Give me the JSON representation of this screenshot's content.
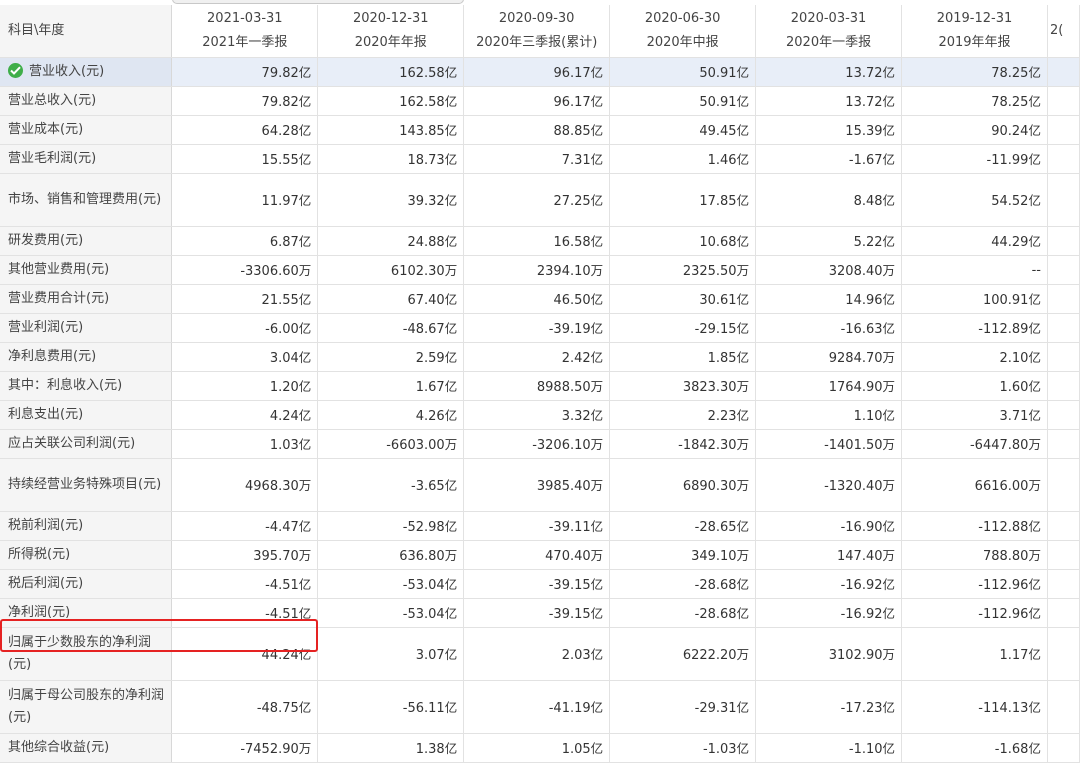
{
  "header": {
    "label": "科目\\年度",
    "columns": [
      {
        "date": "2021-03-31",
        "period": "2021年一季报"
      },
      {
        "date": "2020-12-31",
        "period": "2020年年报"
      },
      {
        "date": "2020-09-30",
        "period": "2020年三季报(累计)"
      },
      {
        "date": "2020-06-30",
        "period": "2020年中报"
      },
      {
        "date": "2020-03-31",
        "period": "2020年一季报"
      },
      {
        "date": "2019-12-31",
        "period": "2019年年报"
      },
      {
        "date": "",
        "period": "2("
      }
    ]
  },
  "rows": [
    {
      "label": "营业收入(元)",
      "values": [
        [
          "79.82",
          "亿"
        ],
        [
          "162.58",
          "亿"
        ],
        [
          "96.17",
          "亿"
        ],
        [
          "50.91",
          "亿"
        ],
        [
          "13.72",
          "亿"
        ],
        [
          "78.25",
          "亿"
        ]
      ]
    },
    {
      "label": "营业总收入(元)",
      "values": [
        [
          "79.82",
          "亿"
        ],
        [
          "162.58",
          "亿"
        ],
        [
          "96.17",
          "亿"
        ],
        [
          "50.91",
          "亿"
        ],
        [
          "13.72",
          "亿"
        ],
        [
          "78.25",
          "亿"
        ]
      ]
    },
    {
      "label": "营业成本(元)",
      "values": [
        [
          "64.28",
          "亿"
        ],
        [
          "143.85",
          "亿"
        ],
        [
          "88.85",
          "亿"
        ],
        [
          "49.45",
          "亿"
        ],
        [
          "15.39",
          "亿"
        ],
        [
          "90.24",
          "亿"
        ]
      ]
    },
    {
      "label": "营业毛利润(元)",
      "values": [
        [
          "15.55",
          "亿"
        ],
        [
          "18.73",
          "亿"
        ],
        [
          "7.31",
          "亿"
        ],
        [
          "1.46",
          "亿"
        ],
        [
          "-1.67",
          "亿"
        ],
        [
          "-11.99",
          "亿"
        ]
      ]
    },
    {
      "label": "市场、销售和管理费用(元)",
      "values": [
        [
          "11.97",
          "亿"
        ],
        [
          "39.32",
          "亿"
        ],
        [
          "27.25",
          "亿"
        ],
        [
          "17.85",
          "亿"
        ],
        [
          "8.48",
          "亿"
        ],
        [
          "54.52",
          "亿"
        ]
      ]
    },
    {
      "label": "研发费用(元)",
      "values": [
        [
          "6.87",
          "亿"
        ],
        [
          "24.88",
          "亿"
        ],
        [
          "16.58",
          "亿"
        ],
        [
          "10.68",
          "亿"
        ],
        [
          "5.22",
          "亿"
        ],
        [
          "44.29",
          "亿"
        ]
      ]
    },
    {
      "label": "其他营业费用(元)",
      "values": [
        [
          "-3306.60",
          "万"
        ],
        [
          "6102.30",
          "万"
        ],
        [
          "2394.10",
          "万"
        ],
        [
          "2325.50",
          "万"
        ],
        [
          "3208.40",
          "万"
        ],
        [
          "--",
          ""
        ]
      ]
    },
    {
      "label": "营业费用合计(元)",
      "values": [
        [
          "21.55",
          "亿"
        ],
        [
          "67.40",
          "亿"
        ],
        [
          "46.50",
          "亿"
        ],
        [
          "30.61",
          "亿"
        ],
        [
          "14.96",
          "亿"
        ],
        [
          "100.91",
          "亿"
        ]
      ]
    },
    {
      "label": "营业利润(元)",
      "values": [
        [
          "-6.00",
          "亿"
        ],
        [
          "-48.67",
          "亿"
        ],
        [
          "-39.19",
          "亿"
        ],
        [
          "-29.15",
          "亿"
        ],
        [
          "-16.63",
          "亿"
        ],
        [
          "-112.89",
          "亿"
        ]
      ]
    },
    {
      "label": "净利息费用(元)",
      "values": [
        [
          "3.04",
          "亿"
        ],
        [
          "2.59",
          "亿"
        ],
        [
          "2.42",
          "亿"
        ],
        [
          "1.85",
          "亿"
        ],
        [
          "9284.70",
          "万"
        ],
        [
          "2.10",
          "亿"
        ]
      ]
    },
    {
      "label": "其中：利息收入(元)",
      "values": [
        [
          "1.20",
          "亿"
        ],
        [
          "1.67",
          "亿"
        ],
        [
          "8988.50",
          "万"
        ],
        [
          "3823.30",
          "万"
        ],
        [
          "1764.90",
          "万"
        ],
        [
          "1.60",
          "亿"
        ]
      ]
    },
    {
      "label": "利息支出(元)",
      "values": [
        [
          "4.24",
          "亿"
        ],
        [
          "4.26",
          "亿"
        ],
        [
          "3.32",
          "亿"
        ],
        [
          "2.23",
          "亿"
        ],
        [
          "1.10",
          "亿"
        ],
        [
          "3.71",
          "亿"
        ]
      ]
    },
    {
      "label": "应占关联公司利润(元)",
      "values": [
        [
          "1.03",
          "亿"
        ],
        [
          "-6603.00",
          "万"
        ],
        [
          "-3206.10",
          "万"
        ],
        [
          "-1842.30",
          "万"
        ],
        [
          "-1401.50",
          "万"
        ],
        [
          "-6447.80",
          "万"
        ]
      ]
    },
    {
      "label": "持续经营业务特殊项目(元)",
      "values": [
        [
          "4968.30",
          "万"
        ],
        [
          "-3.65",
          "亿"
        ],
        [
          "3985.40",
          "万"
        ],
        [
          "6890.30",
          "万"
        ],
        [
          "-1320.40",
          "万"
        ],
        [
          "6616.00",
          "万"
        ]
      ]
    },
    {
      "label": "税前利润(元)",
      "values": [
        [
          "-4.47",
          "亿"
        ],
        [
          "-52.98",
          "亿"
        ],
        [
          "-39.11",
          "亿"
        ],
        [
          "-28.65",
          "亿"
        ],
        [
          "-16.90",
          "亿"
        ],
        [
          "-112.88",
          "亿"
        ]
      ]
    },
    {
      "label": "所得税(元)",
      "values": [
        [
          "395.70",
          "万"
        ],
        [
          "636.80",
          "万"
        ],
        [
          "470.40",
          "万"
        ],
        [
          "349.10",
          "万"
        ],
        [
          "147.40",
          "万"
        ],
        [
          "788.80",
          "万"
        ]
      ]
    },
    {
      "label": "税后利润(元)",
      "values": [
        [
          "-4.51",
          "亿"
        ],
        [
          "-53.04",
          "亿"
        ],
        [
          "-39.15",
          "亿"
        ],
        [
          "-28.68",
          "亿"
        ],
        [
          "-16.92",
          "亿"
        ],
        [
          "-112.96",
          "亿"
        ]
      ]
    },
    {
      "label": "净利润(元)",
      "values": [
        [
          "-4.51",
          "亿"
        ],
        [
          "-53.04",
          "亿"
        ],
        [
          "-39.15",
          "亿"
        ],
        [
          "-28.68",
          "亿"
        ],
        [
          "-16.92",
          "亿"
        ],
        [
          "-112.96",
          "亿"
        ]
      ]
    },
    {
      "label": "归属于少数股东的净利润(元)",
      "values": [
        [
          "44.24",
          "亿"
        ],
        [
          "3.07",
          "亿"
        ],
        [
          "2.03",
          "亿"
        ],
        [
          "6222.20",
          "万"
        ],
        [
          "3102.90",
          "万"
        ],
        [
          "1.17",
          "亿"
        ]
      ]
    },
    {
      "label": "归属于母公司股东的净利润(元)",
      "values": [
        [
          "-48.75",
          "亿"
        ],
        [
          "-56.11",
          "亿"
        ],
        [
          "-41.19",
          "亿"
        ],
        [
          "-29.31",
          "亿"
        ],
        [
          "-17.23",
          "亿"
        ],
        [
          "-114.13",
          "亿"
        ]
      ]
    },
    {
      "label": "其他综合收益(元)",
      "values": [
        [
          "-7452.90",
          "万"
        ],
        [
          "1.38",
          "亿"
        ],
        [
          "1.05",
          "亿"
        ],
        [
          "-1.03",
          "亿"
        ],
        [
          "-1.10",
          "亿"
        ],
        [
          "-1.68",
          "亿"
        ]
      ]
    }
  ],
  "selected_row": 0,
  "highlighted_row": 17,
  "colors": {
    "selected_bg": "#e8eef8",
    "highlight_border": "#e52222",
    "check": "#3fae49"
  }
}
